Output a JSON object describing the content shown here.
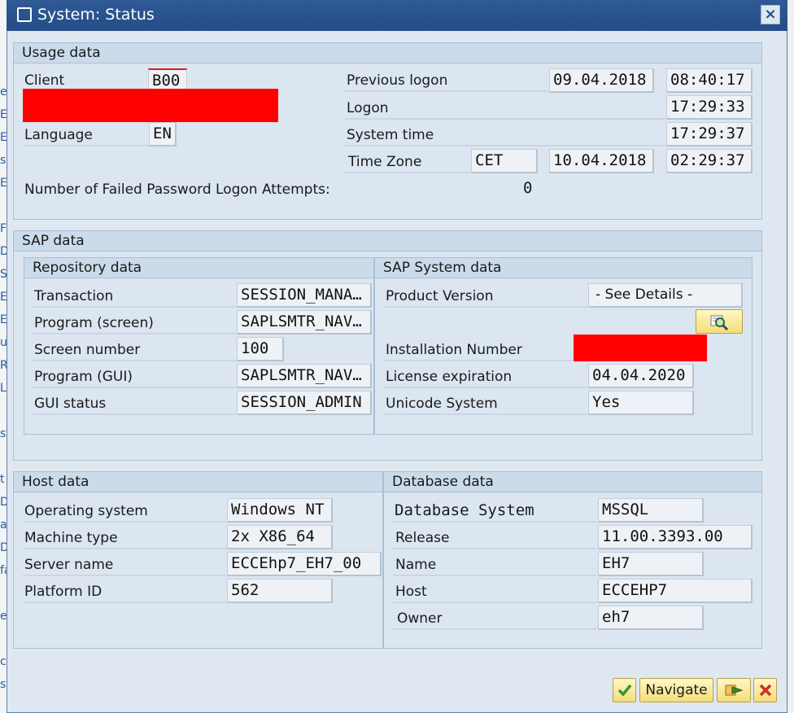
{
  "window": {
    "title": "System: Status",
    "close_icon": "×"
  },
  "background_left": [
    "e",
    "E",
    "E",
    "s",
    "E",
    "",
    "F",
    "D",
    "S",
    "E",
    "E",
    "u",
    "R",
    "L",
    "",
    "st",
    "",
    "t",
    "D",
    "a",
    "D",
    "fa",
    "",
    "es",
    "",
    "ce",
    "st"
  ],
  "usage": {
    "header": "Usage data",
    "client_label": "Client",
    "client_value": "B00",
    "language_label": "Language",
    "language_value": "EN",
    "prev_logon_label": "Previous logon",
    "prev_logon_date": "09.04.2018",
    "prev_logon_time": "08:40:17",
    "logon_label": "Logon",
    "logon_time": "17:29:33",
    "system_time_label": "System time",
    "system_time": "17:29:37",
    "timezone_label": "Time Zone",
    "timezone": "CET",
    "tz_date": "10.04.2018",
    "tz_time": "02:29:37",
    "failed_label": "Number of Failed Password Logon Attempts:",
    "failed_value": "0"
  },
  "sap": {
    "header": "SAP data",
    "repo_header": "Repository data",
    "repo": [
      {
        "label": "Transaction",
        "value": "SESSION_MANA…"
      },
      {
        "label": "Program (screen)",
        "value": "SAPLSMTR_NAV…"
      },
      {
        "label": "Screen number",
        "value": "100"
      },
      {
        "label": "Program (GUI)",
        "value": "SAPLSMTR_NAV…"
      },
      {
        "label": "GUI status",
        "value": "SESSION_ADMIN"
      }
    ],
    "system_header": "SAP System data",
    "product_version_label": "Product Version",
    "product_version_value": "- See Details -",
    "details_icon": "magnifier-icon",
    "installation_label": "Installation Number",
    "license_label": "License expiration",
    "license_value": "04.04.2020",
    "unicode_label": "Unicode System",
    "unicode_value": "Yes"
  },
  "host": {
    "header": "Host data",
    "rows": [
      {
        "label": "Operating system",
        "value": "Windows NT"
      },
      {
        "label": "Machine type",
        "value": "2x X86_64"
      },
      {
        "label": "Server name",
        "value": "ECCEhp7_EH7_00"
      },
      {
        "label": "Platform ID",
        "value": "562"
      }
    ]
  },
  "db": {
    "header": "Database data",
    "rows": [
      {
        "label": "Database System",
        "value": "MSSQL"
      },
      {
        "label": "Release",
        "value": "11.00.3393.00"
      },
      {
        "label": "Name",
        "value": "EH7"
      },
      {
        "label": "Host",
        "value": "ECCEHP7"
      },
      {
        "label": "Owner",
        "value": "eh7"
      }
    ]
  },
  "footer": {
    "navigate_label": "Navigate"
  },
  "colors": {
    "title_bar": "#254d87",
    "redaction": "#ff0000",
    "accept": "#2f9a2f",
    "cancel": "#d03020"
  }
}
